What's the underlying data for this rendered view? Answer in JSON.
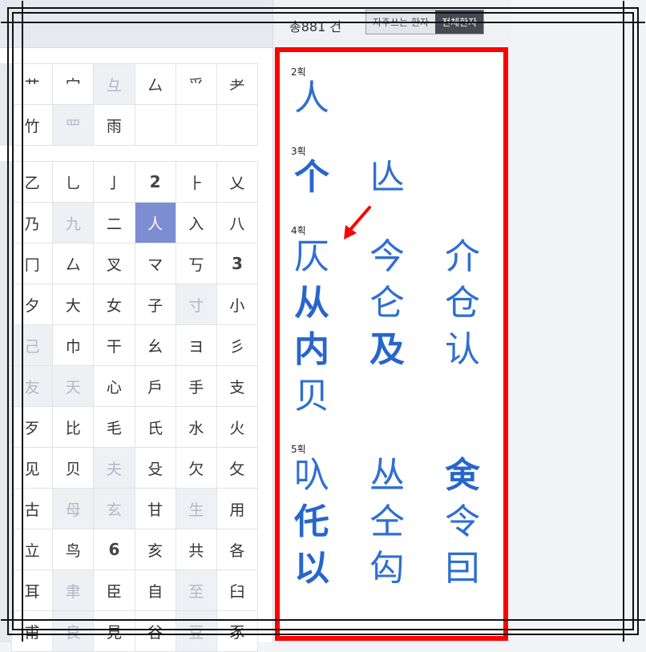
{
  "header": {
    "total_prefix": "총",
    "total_count": "881",
    "total_suffix": "건",
    "tabs": [
      {
        "label": "자주쓰는 한자",
        "active": false
      },
      {
        "label": "전체한자",
        "active": true
      }
    ]
  },
  "radical_grid_top": [
    {
      "ch": "艹",
      "dim": false
    },
    {
      "ch": "宀",
      "dim": false
    },
    {
      "ch": "彑",
      "dim": true
    },
    {
      "ch": "厶",
      "dim": false
    },
    {
      "ch": "爫",
      "dim": false
    },
    {
      "ch": "耂",
      "dim": false
    },
    {
      "ch": "竹",
      "dim": false
    },
    {
      "ch": "罒",
      "dim": true
    },
    {
      "ch": "雨",
      "dim": false
    },
    {
      "ch": "",
      "dim": false
    },
    {
      "ch": "",
      "dim": false
    },
    {
      "ch": "",
      "dim": false
    }
  ],
  "radical_grid_main": [
    {
      "ch": "乙"
    },
    {
      "ch": "乚"
    },
    {
      "ch": "亅"
    },
    {
      "ch": "2",
      "num": true
    },
    {
      "ch": "⺊"
    },
    {
      "ch": "乂"
    },
    {
      "ch": "乃"
    },
    {
      "ch": "九",
      "dim": true
    },
    {
      "ch": "二"
    },
    {
      "ch": "人",
      "sel": true
    },
    {
      "ch": "入"
    },
    {
      "ch": "八"
    },
    {
      "ch": "冂"
    },
    {
      "ch": "厶"
    },
    {
      "ch": "叉"
    },
    {
      "ch": "マ"
    },
    {
      "ch": "丂"
    },
    {
      "ch": "3",
      "num": true
    },
    {
      "ch": "夕"
    },
    {
      "ch": "大"
    },
    {
      "ch": "女"
    },
    {
      "ch": "子"
    },
    {
      "ch": "寸",
      "dim": true
    },
    {
      "ch": "小"
    },
    {
      "ch": "己",
      "dim": true
    },
    {
      "ch": "巾"
    },
    {
      "ch": "干"
    },
    {
      "ch": "幺"
    },
    {
      "ch": "ヨ"
    },
    {
      "ch": "彡"
    },
    {
      "ch": "友",
      "dim": true
    },
    {
      "ch": "天",
      "dim": true
    },
    {
      "ch": "心"
    },
    {
      "ch": "戶"
    },
    {
      "ch": "手"
    },
    {
      "ch": "支"
    },
    {
      "ch": "歹"
    },
    {
      "ch": "比"
    },
    {
      "ch": "毛"
    },
    {
      "ch": "氏"
    },
    {
      "ch": "水"
    },
    {
      "ch": "火"
    },
    {
      "ch": "见"
    },
    {
      "ch": "贝"
    },
    {
      "ch": "夫",
      "dim": true
    },
    {
      "ch": "殳"
    },
    {
      "ch": "欠"
    },
    {
      "ch": "攵"
    },
    {
      "ch": "古"
    },
    {
      "ch": "母",
      "dim": true
    },
    {
      "ch": "玄",
      "dim": true
    },
    {
      "ch": "甘"
    },
    {
      "ch": "生",
      "dim": true
    },
    {
      "ch": "用"
    },
    {
      "ch": "立"
    },
    {
      "ch": "鸟"
    },
    {
      "ch": "6",
      "num": true
    },
    {
      "ch": "亥"
    },
    {
      "ch": "共"
    },
    {
      "ch": "各"
    },
    {
      "ch": "耳"
    },
    {
      "ch": "聿",
      "dim": true
    },
    {
      "ch": "臣"
    },
    {
      "ch": "自"
    },
    {
      "ch": "至",
      "dim": true
    },
    {
      "ch": "臼"
    },
    {
      "ch": "甫"
    },
    {
      "ch": "良",
      "dim": true
    },
    {
      "ch": "見"
    },
    {
      "ch": "谷"
    },
    {
      "ch": "豆",
      "dim": true
    },
    {
      "ch": "豕"
    }
  ],
  "results": [
    {
      "stroke_label": "2획",
      "chars": [
        {
          "ch": "人",
          "bold": false
        }
      ]
    },
    {
      "stroke_label": "3획",
      "chars": [
        {
          "ch": "个",
          "bold": true
        },
        {
          "ch": "亾",
          "bold": false
        }
      ]
    },
    {
      "stroke_label": "4획",
      "chars": [
        {
          "ch": "仄",
          "bold": false
        },
        {
          "ch": "今",
          "bold": false
        },
        {
          "ch": "介",
          "bold": false
        },
        {
          "ch": "从",
          "bold": true
        },
        {
          "ch": "仑",
          "bold": false
        },
        {
          "ch": "仓",
          "bold": false
        },
        {
          "ch": "内",
          "bold": true
        },
        {
          "ch": "及",
          "bold": true
        },
        {
          "ch": "认",
          "bold": false
        },
        {
          "ch": "贝",
          "bold": false
        }
      ]
    },
    {
      "stroke_label": "5획",
      "chars": [
        {
          "ch": "叺",
          "bold": false
        },
        {
          "ch": "丛",
          "bold": false
        },
        {
          "ch": "㑒",
          "bold": true
        },
        {
          "ch": "仛",
          "bold": true
        },
        {
          "ch": "仝",
          "bold": false
        },
        {
          "ch": "令",
          "bold": false
        },
        {
          "ch": "以",
          "bold": true
        },
        {
          "ch": "匃",
          "bold": false
        },
        {
          "ch": "囙",
          "bold": false
        }
      ]
    }
  ],
  "colors": {
    "highlight_border": "#ff0000",
    "selected_cell": "#7c8ed1",
    "hanja": "#2f6fd1"
  }
}
